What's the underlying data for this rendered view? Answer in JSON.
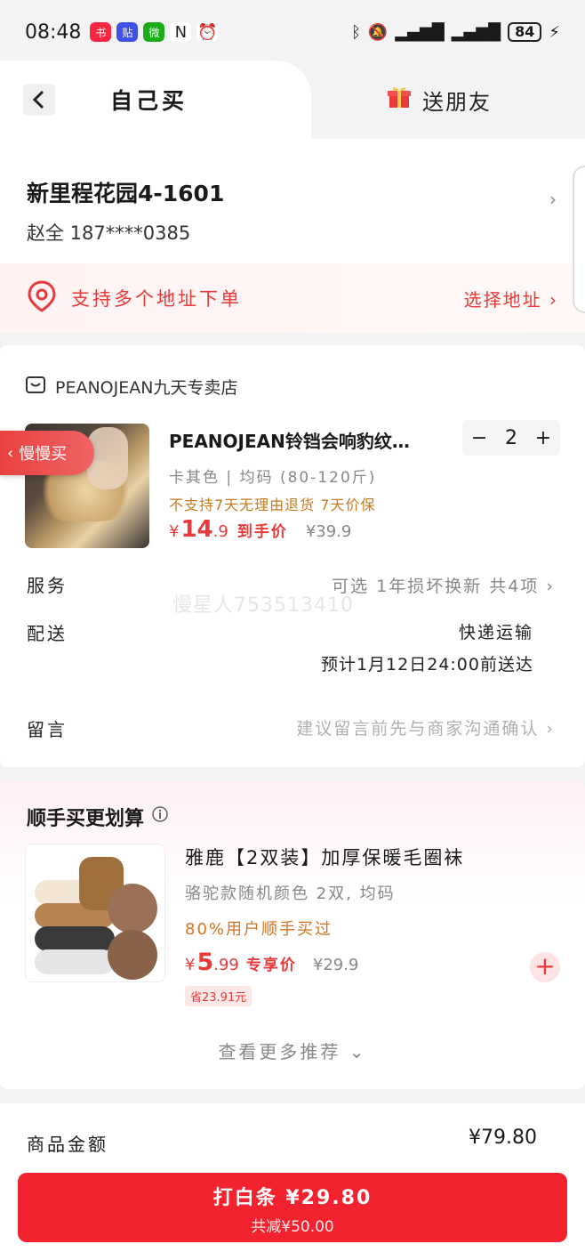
{
  "status_bar": {
    "time": "08:48",
    "battery": "84",
    "apps": [
      {
        "name": "xiaohongshu-icon",
        "label": "小红书",
        "color": "#ff2442"
      },
      {
        "name": "tieba-icon",
        "label": "贴",
        "color": "#3f51e8"
      },
      {
        "name": "wechat-icon",
        "label": "微",
        "color": "#1aad19"
      }
    ]
  },
  "tabs": {
    "self": "自己买",
    "friend": "送朋友"
  },
  "address": {
    "title": "新里程花园4-1601",
    "recipient": "赵全  187****0385",
    "multi_text": "支持多个地址下单",
    "select": "选择地址 ›"
  },
  "order": {
    "shop_name": "PEANOJEAN九天专卖店",
    "slow_tag": "慢慢买",
    "product_title": "PEANOJEAN铃铛会响豹纹…",
    "quantity": "2",
    "minus": "−",
    "plus": "+",
    "spec": "卡其色 | 均码 (80-120斤)",
    "warn": "不支持7天无理由退货 7天价保",
    "price_currency": "¥",
    "price_int": "14",
    "price_dec": ".9",
    "price_label": "到手价",
    "price_orig": "¥39.9",
    "service_label": "服务",
    "service_value": "可选 1年损坏换新 共4项 ›",
    "delivery_label": "配送",
    "delivery_method": "快递运输",
    "delivery_eta": "预计1月12日24:00前送达",
    "message_label": "留言",
    "message_placeholder": "建议留言前先与商家沟通确认 ›",
    "watermark": "慢星人753513410"
  },
  "recommend": {
    "title": "顺手买更划算",
    "name": "雅鹿【2双装】加厚保暖毛圈袜",
    "spec": "骆驼款随机颜色 2双, 均码",
    "popularity": "80%用户顺手买过",
    "price_currency": "¥",
    "price_int": "5",
    "price_dec": ".99",
    "price_label": "专享价",
    "price_orig": "¥29.9",
    "save": "省23.91元",
    "more": "查看更多推荐 ⌄"
  },
  "summary": {
    "goods_label": "商品金额",
    "goods_value": "¥79.80"
  },
  "pay": {
    "main": "打白条 ¥29.80",
    "sub": "共减¥50.00"
  },
  "colors": {
    "accent": "#f2222e",
    "warn": "#c77a1e"
  }
}
